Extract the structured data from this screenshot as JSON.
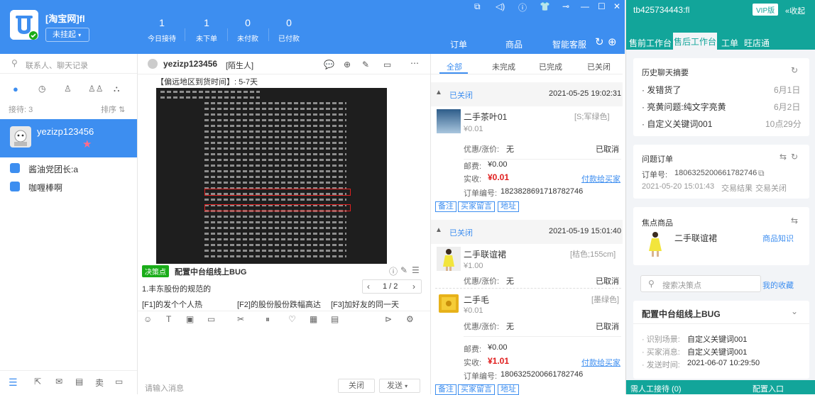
{
  "app": {
    "shop_name": "[淘宝网]fl",
    "status_label": "未挂起",
    "stats": [
      {
        "value": "1",
        "label": "今日接待"
      },
      {
        "value": "1",
        "label": "未下单"
      },
      {
        "value": "0",
        "label": "未付款"
      },
      {
        "value": "0",
        "label": "已付款"
      }
    ]
  },
  "left": {
    "search_placeholder": "联系人、聊天记录",
    "reception_label": "接待: 3",
    "sort_label": "排序",
    "active_chat_name": "yezizp123456",
    "chats": [
      {
        "name": "酱油党团长:a"
      },
      {
        "name": "咖喱棒啊"
      }
    ]
  },
  "chat": {
    "user_name": "yezizp123456",
    "user_tag": "[陌生人]",
    "msg_header": "【偏远地区到货时间】: 5-7天",
    "decision_badge": "决策点",
    "decision_title": "配置中台组线上BUG",
    "decision_item": "1.丰东股份的规范的",
    "pager": "1 / 2",
    "quick_replies": [
      "[F1]的发个个人热",
      "[F2]的股份股份跌幅高达",
      "[F3]加好友的同一天"
    ],
    "input_placeholder": "请输入消息",
    "close_label": "关闭",
    "send_label": "发送"
  },
  "orders": {
    "tabs": [
      "订单",
      "商品",
      "智能客服"
    ],
    "sub_tabs": [
      "全部",
      "未完成",
      "已完成",
      "已关闭"
    ],
    "groups": [
      {
        "status": "已关闭",
        "time": "2021-05-25 19:02:31",
        "items": [
          {
            "name": "二手茶叶01",
            "spec": "[S;军绿色]",
            "price": "¥0.01",
            "discount_label": "优惠/涨价:",
            "discount": "无",
            "state": "已取消"
          }
        ],
        "shipping_label": "邮费:",
        "shipping": "¥0.00",
        "paid_label": "实收:",
        "paid": "¥0.01",
        "pay_link": "付款给买家",
        "order_no_label": "订单编号:",
        "order_no": "1823828691718782746",
        "actions": [
          "备注",
          "买家留言",
          "地址"
        ]
      },
      {
        "status": "已关闭",
        "time": "2021-05-19 15:01:40",
        "items": [
          {
            "name": "二手联谊裙",
            "spec": "[桔色;155cm]",
            "price": "¥1.00",
            "discount_label": "优惠/涨价:",
            "discount": "无",
            "state": "已取消"
          },
          {
            "name": "二手毛",
            "spec": "[墨绿色]",
            "price": "¥0.01",
            "discount_label": "优惠/涨价:",
            "discount": "无",
            "state": "已取消"
          }
        ],
        "shipping_label": "邮费:",
        "shipping": "¥0.00",
        "paid_label": "实收:",
        "paid": "¥1.01",
        "pay_link": "付款给买家",
        "order_no_label": "订单编号:",
        "order_no": "1806325200661782746",
        "actions": [
          "备注",
          "买家留言",
          "地址"
        ]
      }
    ]
  },
  "right": {
    "account": "tb425734443:fl",
    "vip": "VIP版",
    "fold": "收起",
    "tabs": [
      "售前工作台",
      "售后工作台",
      "工单",
      "旺店通"
    ],
    "history": {
      "title": "历史聊天摘要",
      "items": [
        {
          "text": "发错货了",
          "date": "6月1日"
        },
        {
          "text": "亮黄问题:纯文字亮黄",
          "date": "6月2日"
        },
        {
          "text": "自定义关键词001",
          "date": "10点29分"
        }
      ]
    },
    "problem": {
      "title": "问题订单",
      "order_label": "订单号:",
      "order_no": "1806325200661782746",
      "date": "2021-05-20 15:01:43",
      "result_label": "交易结果",
      "result": "交易关闭"
    },
    "focus": {
      "title": "焦点商品",
      "product": "二手联谊裙",
      "link": "商品知识"
    },
    "decision_search_placeholder": "搜索决策点",
    "my_fav": "我的收藏",
    "bug": {
      "title": "配置中台组线上BUG",
      "rows": [
        {
          "label": "识别场景:",
          "value": "自定义关键词001"
        },
        {
          "label": "买家消息:",
          "value": "自定义关键词001"
        },
        {
          "label": "发送时间:",
          "value": "2021-06-07 10:29:50"
        }
      ]
    },
    "footer_left": "需人工接待 (0)",
    "footer_right": "配置入口"
  },
  "colors": {
    "primary": "#3d8ef0",
    "teal": "#12a59a",
    "red": "#e01d1d",
    "badge_green": "#1aad19"
  }
}
